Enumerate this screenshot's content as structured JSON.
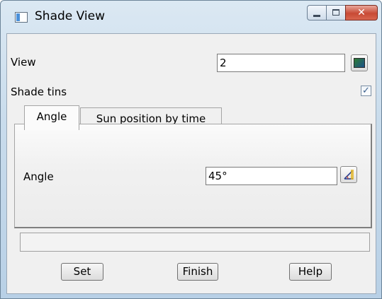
{
  "window": {
    "title": "Shade View"
  },
  "fields": {
    "view": {
      "label": "View",
      "value": "2"
    },
    "shade_tins": {
      "label": "Shade tins",
      "checked": true
    }
  },
  "tabs": [
    {
      "label": "Angle",
      "active": true
    },
    {
      "label": "Sun position by time",
      "active": false
    }
  ],
  "angle": {
    "label": "Angle",
    "value": "45°"
  },
  "status": {
    "text": ""
  },
  "buttons": {
    "set": "Set",
    "finish": "Finish",
    "help": "Help"
  },
  "icons": {
    "app": "window-icon",
    "minimize": "minimize-icon",
    "maximize": "maximize-icon",
    "close": "close-icon",
    "view_pick": "view-picker-icon",
    "angle_pick": "angle-picker-icon",
    "check": "checkmark-icon"
  }
}
